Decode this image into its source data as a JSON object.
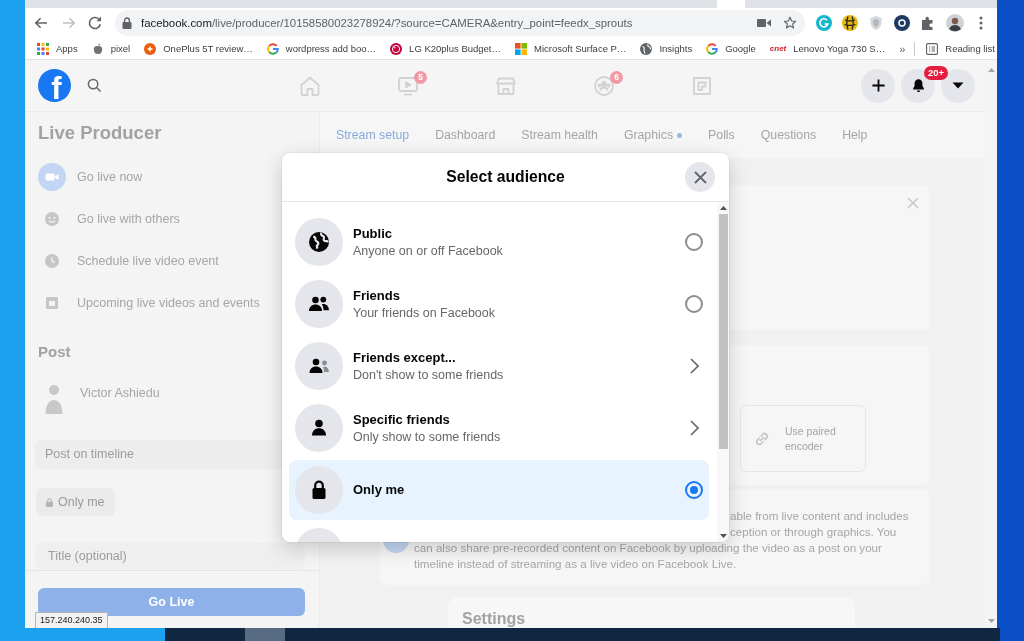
{
  "browser": {
    "url": {
      "host": "facebook.com",
      "path": "/live/producer/10158580023278924/?source=CAMERA&entry_point=feedx_sprouts"
    },
    "bookmarks": [
      {
        "label": "Apps",
        "kind": "apps"
      },
      {
        "label": "pixel",
        "kind": "apple"
      },
      {
        "label": "OnePlus 5T review…",
        "kind": "oneplus"
      },
      {
        "label": "wordpress add boo…",
        "kind": "google"
      },
      {
        "label": "LG K20plus Budget…",
        "kind": "lg"
      },
      {
        "label": "Microsoft Surface P…",
        "kind": "microsoft"
      },
      {
        "label": "Insights",
        "kind": "globe"
      },
      {
        "label": "Google",
        "kind": "google"
      },
      {
        "label": "Lenovo Yoga 730 S…",
        "kind": "cnet",
        "logo_text": "cnet"
      }
    ],
    "more_bookmarks": "»",
    "reading_list": "Reading list",
    "status_text": "157.240.240.35"
  },
  "top_bar": {
    "logo_text": "f",
    "nav": [
      {
        "kind": "home"
      },
      {
        "kind": "video",
        "badge": "5"
      },
      {
        "kind": "store"
      },
      {
        "kind": "groups",
        "badge": "6"
      },
      {
        "kind": "gaming"
      }
    ],
    "notification_badge": "20+"
  },
  "sidebar": {
    "title": "Live Producer",
    "items": [
      {
        "label": "Go live now",
        "kind": "camera",
        "selected": true
      },
      {
        "label": "Go live with others",
        "kind": "group",
        "selected": false
      },
      {
        "label": "Schedule live video event",
        "kind": "clock",
        "selected": false
      },
      {
        "label": "Upcoming live videos and events",
        "kind": "calendar",
        "selected": false
      }
    ],
    "post_heading": "Post",
    "author": "Victor Ashiedu",
    "destination": "Post on timeline",
    "privacy": "Only me",
    "title_placeholder": "Title (optional)",
    "go_live": "Go Live"
  },
  "tabs": [
    {
      "label": "Stream setup",
      "selected": true,
      "dot": false
    },
    {
      "label": "Dashboard",
      "selected": false,
      "dot": false
    },
    {
      "label": "Stream health",
      "selected": false,
      "dot": false
    },
    {
      "label": "Graphics",
      "selected": false,
      "dot": true
    },
    {
      "label": "Polls",
      "selected": false,
      "dot": false
    },
    {
      "label": "Questions",
      "selected": false,
      "dot": false
    },
    {
      "label": "Help",
      "selected": false,
      "dot": false
    }
  ],
  "content": {
    "encoder_option": "Use paired encoder",
    "notice_fragment": [
      "able from live content and includes",
      "ception or through graphics. You"
    ],
    "notice": "can also share pre-recorded content on Facebook by uploading the video as a post on your timeline instead of streaming as a live video on Facebook Live.",
    "settings_heading": "Settings"
  },
  "dialog": {
    "title": "Select audience",
    "options": [
      {
        "title": "Public",
        "subtitle": "Anyone on or off Facebook",
        "kind": "public",
        "submenu": false,
        "selected": false
      },
      {
        "title": "Friends",
        "subtitle": "Your friends on Facebook",
        "kind": "friends",
        "submenu": false,
        "selected": false
      },
      {
        "title": "Friends except...",
        "subtitle": "Don't show to some friends",
        "kind": "friends_except",
        "submenu": true,
        "selected": false
      },
      {
        "title": "Specific friends",
        "subtitle": "Only show to some friends",
        "kind": "specific",
        "submenu": true,
        "selected": false
      },
      {
        "title": "Only me",
        "kind": "only_me",
        "submenu": false,
        "selected": true
      }
    ]
  }
}
